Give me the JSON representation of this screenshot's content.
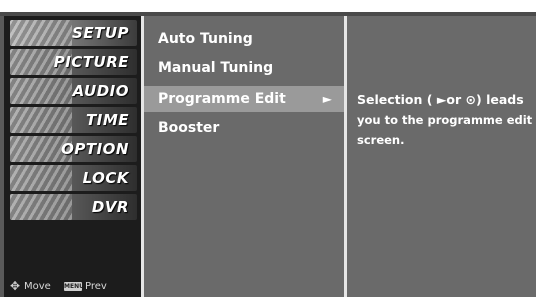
{
  "main_menu": {
    "items": [
      {
        "label": "SETUP",
        "active": true
      },
      {
        "label": "PICTURE"
      },
      {
        "label": "AUDIO"
      },
      {
        "label": "TIME"
      },
      {
        "label": "OPTION"
      },
      {
        "label": "LOCK"
      },
      {
        "label": "DVR"
      }
    ]
  },
  "footer": {
    "move_icon": "dpad-icon",
    "move_label": "Move",
    "menu_key": "MENU",
    "prev_label": "Prev"
  },
  "submenu": {
    "items": [
      {
        "label": "Auto Tuning"
      },
      {
        "label": "Manual Tuning"
      },
      {
        "label": "Programme Edit",
        "selected": true,
        "arrow": "►"
      },
      {
        "label": "Booster"
      }
    ]
  },
  "description": {
    "line1": "Selection ( ►or ⊙) leads",
    "line2": "you to the programme edit",
    "line3": "screen."
  },
  "colors": {
    "panel": "#6a6a6a",
    "selected": "#9a9a9a",
    "left_bg": "#1c1c1c",
    "divider": "#e6e6e6"
  }
}
